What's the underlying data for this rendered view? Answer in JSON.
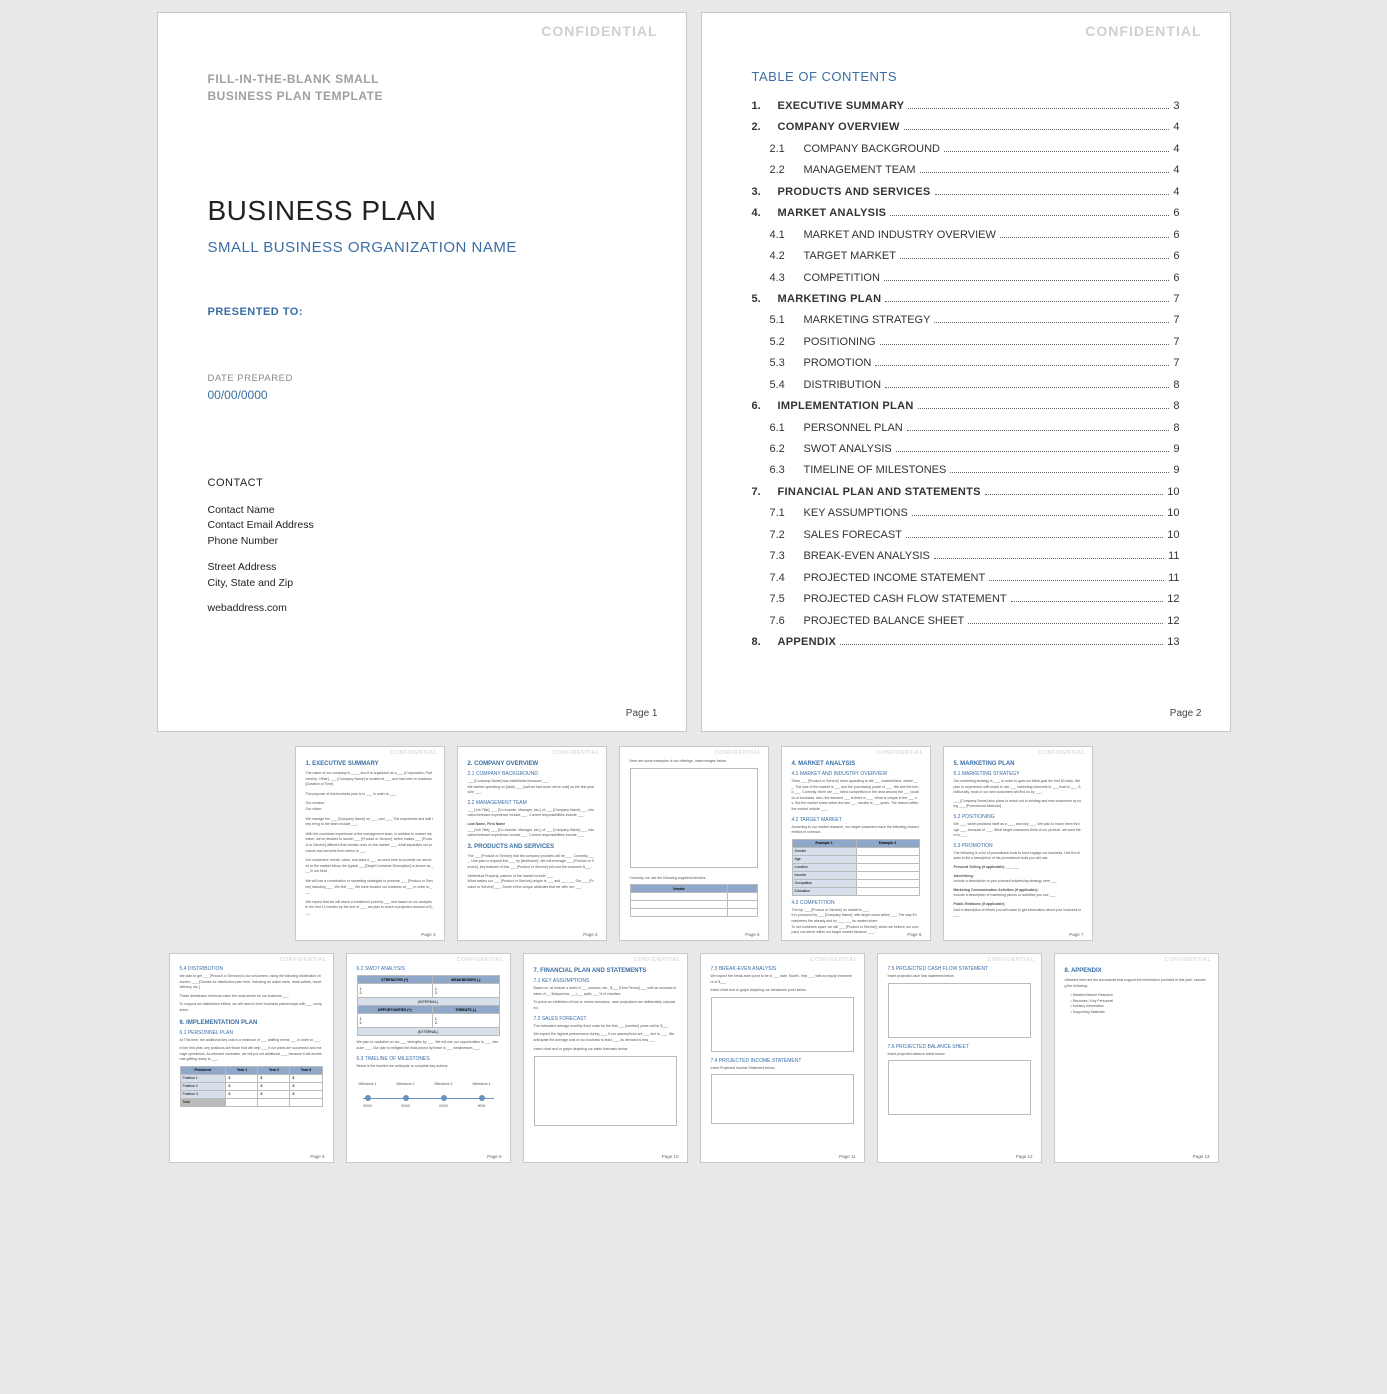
{
  "confidential": "CONFIDENTIAL",
  "page1": {
    "template_line1": "FILL-IN-THE-BLANK SMALL",
    "template_line2": "BUSINESS PLAN TEMPLATE",
    "title": "BUSINESS PLAN",
    "subtitle": "SMALL BUSINESS ORGANIZATION NAME",
    "presented_to": "PRESENTED TO:",
    "date_label": "DATE PREPARED",
    "date_value": "00/00/0000",
    "contact_heading": "CONTACT",
    "contact": {
      "name": "Contact Name",
      "email": "Contact Email Address",
      "phone": "Phone Number",
      "street": "Street Address",
      "city": "City, State and Zip",
      "web": "webaddress.com"
    },
    "page_label": "Page 1"
  },
  "page2": {
    "toc_title": "TABLE OF CONTENTS",
    "entries": [
      {
        "num": "1.",
        "label": "EXECUTIVE SUMMARY",
        "page": "3",
        "level": "main"
      },
      {
        "num": "2.",
        "label": "COMPANY OVERVIEW",
        "page": "4",
        "level": "main"
      },
      {
        "num": "2.1",
        "label": "COMPANY BACKGROUND",
        "page": "4",
        "level": "sub"
      },
      {
        "num": "2.2",
        "label": "MANAGEMENT TEAM",
        "page": "4",
        "level": "sub"
      },
      {
        "num": "3.",
        "label": "PRODUCTS AND SERVICES",
        "page": "4",
        "level": "main"
      },
      {
        "num": "4.",
        "label": "MARKET ANALYSIS",
        "page": "6",
        "level": "main"
      },
      {
        "num": "4.1",
        "label": "MARKET AND INDUSTRY OVERVIEW",
        "page": "6",
        "level": "sub"
      },
      {
        "num": "4.2",
        "label": "TARGET MARKET",
        "page": "6",
        "level": "sub"
      },
      {
        "num": "4.3",
        "label": "COMPETITION",
        "page": "6",
        "level": "sub"
      },
      {
        "num": "5.",
        "label": "MARKETING PLAN",
        "page": "7",
        "level": "main"
      },
      {
        "num": "5.1",
        "label": "MARKETING STRATEGY",
        "page": "7",
        "level": "sub"
      },
      {
        "num": "5.2",
        "label": "POSITIONING",
        "page": "7",
        "level": "sub"
      },
      {
        "num": "5.3",
        "label": "PROMOTION",
        "page": "7",
        "level": "sub"
      },
      {
        "num": "5.4",
        "label": "DISTRIBUTION",
        "page": "8",
        "level": "sub"
      },
      {
        "num": "6.",
        "label": "IMPLEMENTATION PLAN",
        "page": "8",
        "level": "main"
      },
      {
        "num": "6.1",
        "label": "PERSONNEL PLAN",
        "page": "8",
        "level": "sub"
      },
      {
        "num": "6.2",
        "label": "SWOT ANALYSIS",
        "page": "9",
        "level": "sub"
      },
      {
        "num": "6.3",
        "label": "TIMELINE OF MILESTONES",
        "page": "9",
        "level": "sub"
      },
      {
        "num": "7.",
        "label": "FINANCIAL PLAN AND STATEMENTS",
        "page": "10",
        "level": "main"
      },
      {
        "num": "7.1",
        "label": "KEY ASSUMPTIONS",
        "page": "10",
        "level": "sub"
      },
      {
        "num": "7.2",
        "label": "SALES FORECAST",
        "page": "10",
        "level": "sub"
      },
      {
        "num": "7.3",
        "label": "BREAK-EVEN ANALYSIS",
        "page": "11",
        "level": "sub"
      },
      {
        "num": "7.4",
        "label": "PROJECTED INCOME STATEMENT",
        "page": "11",
        "level": "sub"
      },
      {
        "num": "7.5",
        "label": "PROJECTED CASH FLOW STATEMENT",
        "page": "12",
        "level": "sub"
      },
      {
        "num": "7.6",
        "label": "PROJECTED BALANCE SHEET",
        "page": "12",
        "level": "sub"
      },
      {
        "num": "8.",
        "label": "APPENDIX",
        "page": "13",
        "level": "main"
      }
    ],
    "page_label": "Page 2"
  },
  "thumbs_row1": [
    {
      "heading": "1.   EXECUTIVE SUMMARY",
      "pnum": "Page 3"
    },
    {
      "heading": "2.   COMPANY OVERVIEW",
      "sub1": "2.1   COMPANY BACKGROUND",
      "sub2": "2.2   MANAGEMENT TEAM",
      "sub3": "3.   PRODUCTS AND SERVICES",
      "pnum": "Page 4"
    },
    {
      "caption": "Here are some examples of our offerings. Insert images below.",
      "sub": "Currently, we use the following suppliers/vendors:",
      "pnum": "Page 5"
    },
    {
      "heading": "4.   MARKET ANALYSIS",
      "sub1": "4.1   MARKET AND INDUSTRY OVERVIEW",
      "sub2": "4.2   TARGET MARKET",
      "sub3": "4.3   COMPETITION",
      "pnum": "Page 6"
    },
    {
      "heading": "5.   MARKETING PLAN",
      "sub1": "5.1   MARKETING STRATEGY",
      "sub2": "5.2   POSITIONING",
      "sub3": "5.3   PROMOTION",
      "pnum": "Page 7"
    }
  ],
  "thumbs_row2": [
    {
      "sub1": "5.4   DISTRIBUTION",
      "heading": "6.   IMPLEMENTATION PLAN",
      "sub2": "6.1   PERSONNEL PLAN",
      "pnum": "Page 8"
    },
    {
      "sub1": "6.2   SWOT ANALYSIS",
      "sub2": "6.3   TIMELINE OF MILESTONES",
      "timeline": {
        "m1": "Milestone 1",
        "d1": "00/00",
        "m2": "Milestone 2",
        "d2": "00/00",
        "m3": "Milestone 3",
        "d3": "00/00",
        "m4": "Milestone 4",
        "d4": "0000"
      },
      "pnum": "Page 9"
    },
    {
      "heading": "7.   FINANCIAL PLAN AND STATEMENTS",
      "sub1": "7.1   KEY ASSUMPTIONS",
      "sub2": "7.2   SALES FORECAST",
      "pnum": "Page 10"
    },
    {
      "sub1": "7.3   BREAK-EVEN ANALYSIS",
      "sub2": "7.4   PROJECTED INCOME STATEMENT",
      "pnum": "Page 11"
    },
    {
      "sub1": "7.5   PROJECTED CASH FLOW STATEMENT",
      "sub2": "7.6   PROJECTED BALANCE SHEET",
      "pnum": "Page 12"
    },
    {
      "heading": "8.   APPENDIX",
      "pnum": "Page 13"
    }
  ],
  "swot": {
    "s": "STRENGTHS (+)",
    "w": "WEAKNESSES (-)",
    "o": "OPPORTUNITIES (+)",
    "t": "THREATS (-)",
    "int": "(INTERNAL)",
    "ext": "(EXTERNAL)"
  },
  "personnel": {
    "h1": "Personnel",
    "h2": "Year 1",
    "h3": "Year 2",
    "h4": "Year 3",
    "r1": "Position 1",
    "r2": "Position 2",
    "r3": "Position 3",
    "tot": "Total"
  }
}
